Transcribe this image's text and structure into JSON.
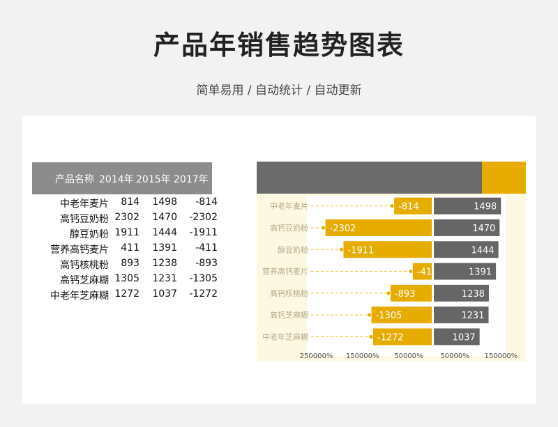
{
  "header": {
    "title": "产品年销售趋势图表",
    "subtitle": "简单易用 / 自动统计 / 自动更新"
  },
  "table": {
    "columns": [
      "产品名称",
      "2014年",
      "2015年",
      "2017年"
    ],
    "rows": [
      [
        "中老年麦片",
        "814",
        "1498",
        "-814"
      ],
      [
        "高钙豆奶粉",
        "2302",
        "1470",
        "-2302"
      ],
      [
        "醇豆奶粉",
        "1911",
        "1444",
        "-1911"
      ],
      [
        "营养高钙麦片",
        "411",
        "1391",
        "-411"
      ],
      [
        "高钙核桃粉",
        "893",
        "1238",
        "-893"
      ],
      [
        "高钙芝麻糊",
        "1305",
        "1231",
        "-1305"
      ],
      [
        "中老年芝麻糊",
        "1272",
        "1037",
        "-1272"
      ]
    ]
  },
  "chart_data": {
    "type": "bar",
    "orientation": "horizontal-butterfly",
    "categories": [
      "中老年麦片",
      "高钙豆奶粉",
      "醇豆奶粉",
      "营养高钙麦片",
      "高钙核桃粉",
      "高钙芝麻糊",
      "中老年芝麻糊"
    ],
    "series": [
      {
        "name": "2014年",
        "values": [
          -814,
          -2302,
          -1911,
          -411,
          -893,
          -1305,
          -1272
        ],
        "color": "#e6ac00"
      },
      {
        "name": "2015年",
        "values": [
          1498,
          1470,
          1444,
          1391,
          1238,
          1231,
          1037
        ],
        "color": "#666666"
      }
    ],
    "xlim": [
      -2600,
      1850
    ],
    "x_ticks": [
      {
        "value": -2500,
        "label": "250000%"
      },
      {
        "value": -1500,
        "label": "150000%"
      },
      {
        "value": -500,
        "label": "50000%"
      },
      {
        "value": 500,
        "label": "50000%"
      },
      {
        "value": 1500,
        "label": "150000%"
      }
    ],
    "legend_position": "top",
    "colors": {
      "negative": "#e6ac00",
      "positive": "#666666",
      "plot_bg": "#fdf8e2",
      "header_dark": "#6b6b6b",
      "header_accent": "#e6ac00",
      "leader": "#f0c020",
      "label_text": "#b5a98a"
    }
  }
}
